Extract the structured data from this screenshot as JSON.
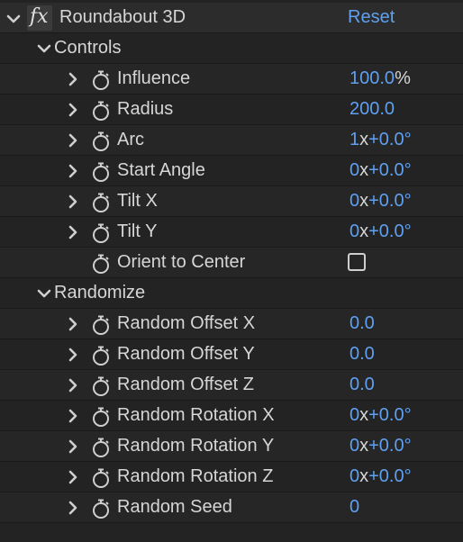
{
  "effect": {
    "fx_label": "fx",
    "name": "Roundabout 3D",
    "reset_label": "Reset"
  },
  "groups": {
    "controls": "Controls",
    "randomize": "Randomize"
  },
  "controls": [
    {
      "name": "Influence",
      "value": "100.0",
      "unit": "%"
    },
    {
      "name": "Radius",
      "value": "200.0"
    },
    {
      "name": "Arc",
      "rev": "1",
      "x": "x",
      "deg": "+0.0°"
    },
    {
      "name": "Start Angle",
      "rev": "0",
      "x": "x",
      "deg": "+0.0°"
    },
    {
      "name": "Tilt X",
      "rev": "0",
      "x": "x",
      "deg": "+0.0°"
    },
    {
      "name": "Tilt Y",
      "rev": "0",
      "x": "x",
      "deg": "+0.0°"
    },
    {
      "name": "Orient to Center"
    }
  ],
  "randomize": [
    {
      "name": "Random Offset X",
      "value": "0.0"
    },
    {
      "name": "Random Offset Y",
      "value": "0.0"
    },
    {
      "name": "Random Offset Z",
      "value": "0.0"
    },
    {
      "name": "Random Rotation X",
      "rev": "0",
      "x": "x",
      "deg": "+0.0°"
    },
    {
      "name": "Random Rotation Y",
      "rev": "0",
      "x": "x",
      "deg": "+0.0°"
    },
    {
      "name": "Random Rotation Z",
      "rev": "0",
      "x": "x",
      "deg": "+0.0°"
    },
    {
      "name": "Random Seed",
      "value": "0"
    }
  ]
}
